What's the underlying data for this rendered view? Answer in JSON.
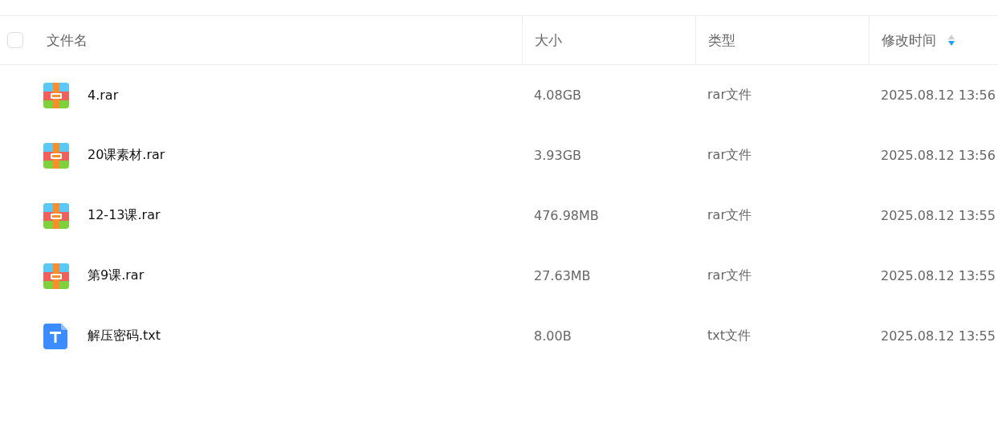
{
  "table": {
    "select_all": {
      "checked": false
    },
    "columns": [
      {
        "label": "文件名",
        "sorted_descending": false
      },
      {
        "label": "大小",
        "sorted_descending": false
      },
      {
        "label": "类型",
        "sorted_descending": false
      },
      {
        "label": "修改时间",
        "sorted_descending": true
      }
    ],
    "rows": [
      {
        "kind": "rar",
        "name": "4.rar",
        "size": "4.08GB",
        "type": "rar文件",
        "modified": "2025.08.12 13:56"
      },
      {
        "kind": "rar",
        "name": "20课素材.rar",
        "size": "3.93GB",
        "type": "rar文件",
        "modified": "2025.08.12 13:56"
      },
      {
        "kind": "rar",
        "name": "12-13课.rar",
        "size": "476.98MB",
        "type": "rar文件",
        "modified": "2025.08.12 13:55"
      },
      {
        "kind": "rar",
        "name": "第9课.rar",
        "size": "27.63MB",
        "type": "rar文件",
        "modified": "2025.08.12 13:55"
      },
      {
        "kind": "txt",
        "name": "解压密码.txt",
        "size": "8.00B",
        "type": "txt文件",
        "modified": "2025.08.12 13:55"
      }
    ]
  }
}
